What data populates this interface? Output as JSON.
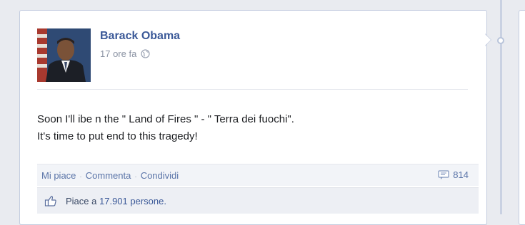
{
  "post": {
    "author": "Barack Obama",
    "time": "17 ore fa",
    "audience_icon": "globe-icon",
    "text_line1": "Soon I'll ibe n the \" Land of Fires \" - \" Terra dei fuochi\".",
    "text_line2": "It's time to put end to this tragedy!"
  },
  "actions": {
    "like": "Mi piace",
    "comment": "Commenta",
    "share": "Condividi",
    "separator": "·",
    "comment_count": "814"
  },
  "likes": {
    "prefix": "Piace a",
    "count": "17.901 persone."
  },
  "colors": {
    "link_blue": "#3b5998",
    "card_border": "#c4cde0",
    "page_bg": "#e9ebf0"
  }
}
